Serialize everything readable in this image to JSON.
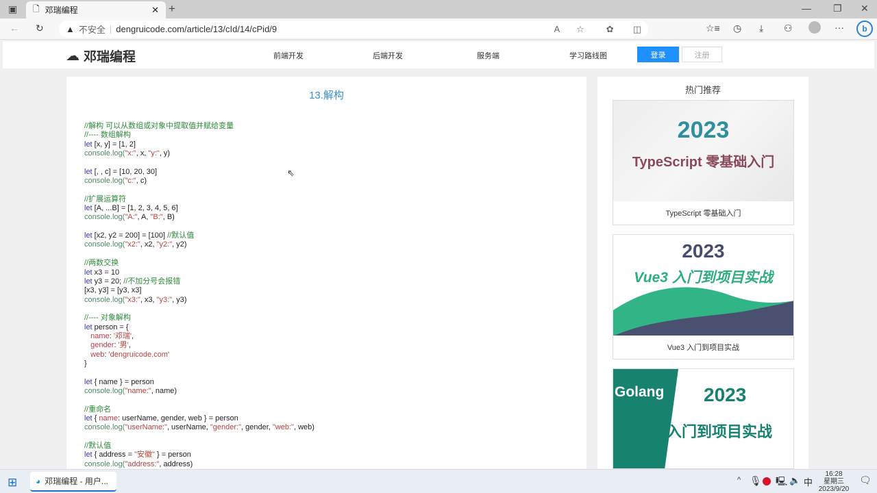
{
  "browser": {
    "tab_title": "邓瑞编程",
    "security": "不安全",
    "url": "dengruicode.com/article/13/cId/14/cPid/9"
  },
  "site": {
    "logo": "邓瑞编程",
    "nav": [
      "前端开发",
      "后端开发",
      "服务端",
      "学习路线图"
    ],
    "login": "登录",
    "register": "注册"
  },
  "article": {
    "title": "13.解构",
    "code": [
      [
        [
          "c",
          "//解构 可以从数组或对象中提取值并赋给变量"
        ]
      ],
      [
        [
          "c",
          "//---- 数组解构"
        ]
      ],
      [
        [
          "k",
          "let"
        ],
        [
          "t",
          " [x, y] = [1, 2]"
        ]
      ],
      [
        [
          "f",
          "console.log("
        ],
        [
          "s",
          "\"x:\""
        ],
        [
          "t",
          ", x, "
        ],
        [
          "s",
          "\"y:\""
        ],
        [
          "t",
          ", y)"
        ]
      ],
      [],
      [
        [
          "k",
          "let"
        ],
        [
          "t",
          " [, , c] = [10, 20, 30]"
        ]
      ],
      [
        [
          "f",
          "console.log("
        ],
        [
          "s",
          "\"c:\""
        ],
        [
          "t",
          ", c)"
        ]
      ],
      [],
      [
        [
          "c",
          "//扩展运算符"
        ]
      ],
      [
        [
          "k",
          "let"
        ],
        [
          "t",
          " [A, ...B] = [1, 2, 3, 4, 5, 6]"
        ]
      ],
      [
        [
          "f",
          "console.log("
        ],
        [
          "s",
          "\"A:\""
        ],
        [
          "t",
          ", A, "
        ],
        [
          "s",
          "\"B:\""
        ],
        [
          "t",
          ", B)"
        ]
      ],
      [],
      [
        [
          "k",
          "let"
        ],
        [
          "t",
          " [x2, y2 = 200] = [100] "
        ],
        [
          "c",
          "//默认值"
        ]
      ],
      [
        [
          "f",
          "console.log("
        ],
        [
          "s",
          "\"x2:\""
        ],
        [
          "t",
          ", x2, "
        ],
        [
          "s",
          "\"y2:\""
        ],
        [
          "t",
          ", y2)"
        ]
      ],
      [],
      [
        [
          "c",
          "//两数交换"
        ]
      ],
      [
        [
          "k",
          "let"
        ],
        [
          "t",
          " x3 = 10"
        ]
      ],
      [
        [
          "k",
          "let"
        ],
        [
          "t",
          " y3 = 20; "
        ],
        [
          "c",
          "//不加分号会报错"
        ]
      ],
      [
        [
          "t",
          "[x3, y3] = [y3, x3]"
        ]
      ],
      [
        [
          "f",
          "console.log("
        ],
        [
          "s",
          "\"x3:\""
        ],
        [
          "t",
          ", x3, "
        ],
        [
          "s",
          "\"y3:\""
        ],
        [
          "t",
          ", y3)"
        ]
      ],
      [],
      [
        [
          "c",
          "//---- 对象解构"
        ]
      ],
      [
        [
          "k",
          "let"
        ],
        [
          "t",
          " person = {"
        ]
      ],
      [
        [
          "t",
          "   "
        ],
        [
          "p",
          "name"
        ],
        [
          "t",
          ": "
        ],
        [
          "s",
          "'邓瑞'"
        ],
        [
          "t",
          ","
        ]
      ],
      [
        [
          "t",
          "   "
        ],
        [
          "p",
          "gender"
        ],
        [
          "t",
          ": "
        ],
        [
          "s",
          "'男'"
        ],
        [
          "t",
          ","
        ]
      ],
      [
        [
          "t",
          "   "
        ],
        [
          "p",
          "web"
        ],
        [
          "t",
          ": "
        ],
        [
          "s",
          "'dengruicode.com'"
        ]
      ],
      [
        [
          "t",
          "}"
        ]
      ],
      [],
      [
        [
          "k",
          "let"
        ],
        [
          "t",
          " { name } = person"
        ]
      ],
      [
        [
          "f",
          "console.log("
        ],
        [
          "s",
          "\"name:\""
        ],
        [
          "t",
          ", name)"
        ]
      ],
      [],
      [
        [
          "c",
          "//重命名"
        ]
      ],
      [
        [
          "k",
          "let"
        ],
        [
          "t",
          " { "
        ],
        [
          "p",
          "name"
        ],
        [
          "t",
          ": userName, gender, web } = person"
        ]
      ],
      [
        [
          "f",
          "console.log("
        ],
        [
          "s",
          "\"userName:\""
        ],
        [
          "t",
          ", userName, "
        ],
        [
          "s",
          "\"gender:\""
        ],
        [
          "t",
          ", gender, "
        ],
        [
          "s",
          "\"web:\""
        ],
        [
          "t",
          ", web)"
        ]
      ],
      [],
      [
        [
          "c",
          "//默认值"
        ]
      ],
      [
        [
          "k",
          "let"
        ],
        [
          "t",
          " { address = "
        ],
        [
          "s",
          "\"安徽\""
        ],
        [
          "t",
          " } = person"
        ]
      ],
      [
        [
          "f",
          "console.log("
        ],
        [
          "s",
          "\"address:\""
        ],
        [
          "t",
          ", address)"
        ]
      ]
    ]
  },
  "sidebar": {
    "title": "热门推荐",
    "courses": [
      {
        "year": "2023",
        "banner": "TypeScript 零基础入门",
        "caption": "TypeScript 零基础入门"
      },
      {
        "year": "2023",
        "banner": "Vue3 入门到项目实战",
        "caption": "Vue3 入门到项目实战"
      },
      {
        "year": "2023",
        "brand": "Golang",
        "banner": "入门到项目实战"
      }
    ]
  },
  "taskbar": {
    "app": "邓瑞编程 - 用户...",
    "ime": "中",
    "time": "16:28",
    "weekday": "星期三",
    "date": "2023/9/20"
  }
}
